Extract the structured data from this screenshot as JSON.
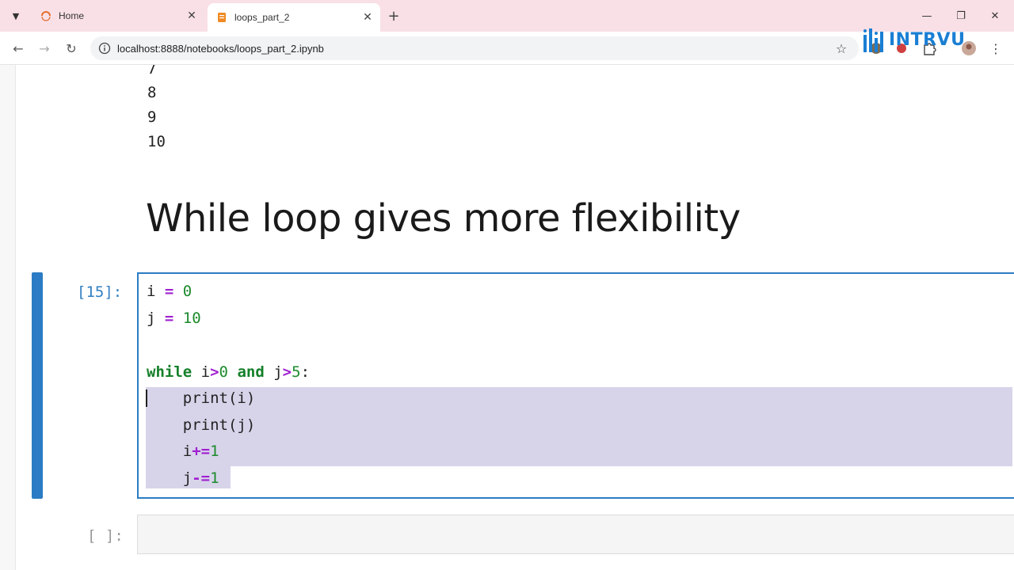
{
  "browser": {
    "tabs": [
      {
        "title": "Home",
        "active": false
      },
      {
        "title": "loops_part_2",
        "active": true
      }
    ],
    "url": "localhost:8888/notebooks/loops_part_2.ipynb",
    "logo_text": "INTRVU"
  },
  "notebook": {
    "output_lines": [
      "7",
      "8",
      "9",
      "10"
    ],
    "markdown_heading": "While loop gives more flexibility",
    "active_cell": {
      "prompt": "[15]:",
      "code": [
        [
          {
            "t": "i ",
            "c": "plain"
          },
          {
            "t": "=",
            "c": "op"
          },
          {
            "t": " ",
            "c": "plain"
          },
          {
            "t": "0",
            "c": "num"
          }
        ],
        [
          {
            "t": "j ",
            "c": "plain"
          },
          {
            "t": "=",
            "c": "op"
          },
          {
            "t": " ",
            "c": "plain"
          },
          {
            "t": "10",
            "c": "num"
          }
        ],
        [],
        [
          {
            "t": "while",
            "c": "kw"
          },
          {
            "t": " i",
            "c": "plain"
          },
          {
            "t": ">",
            "c": "op"
          },
          {
            "t": "0",
            "c": "num"
          },
          {
            "t": " ",
            "c": "plain"
          },
          {
            "t": "and",
            "c": "kw"
          },
          {
            "t": " j",
            "c": "plain"
          },
          {
            "t": ">",
            "c": "op"
          },
          {
            "t": "5",
            "c": "num"
          },
          {
            "t": ":",
            "c": "plain"
          }
        ],
        [
          {
            "t": "    print(i)",
            "c": "plain"
          }
        ],
        [
          {
            "t": "    print(j)",
            "c": "plain"
          }
        ],
        [
          {
            "t": "    i",
            "c": "plain"
          },
          {
            "t": "+=",
            "c": "op"
          },
          {
            "t": "1",
            "c": "num"
          }
        ],
        [
          {
            "t": "    j",
            "c": "plain"
          },
          {
            "t": "-=",
            "c": "op"
          },
          {
            "t": "1",
            "c": "num"
          }
        ]
      ]
    },
    "empty_cell": {
      "prompt": "[ ]:"
    }
  },
  "colors": {
    "accent": "#2b7cc4",
    "selection": "#d7d4ea",
    "tab_strip": "#f9e0e6"
  }
}
